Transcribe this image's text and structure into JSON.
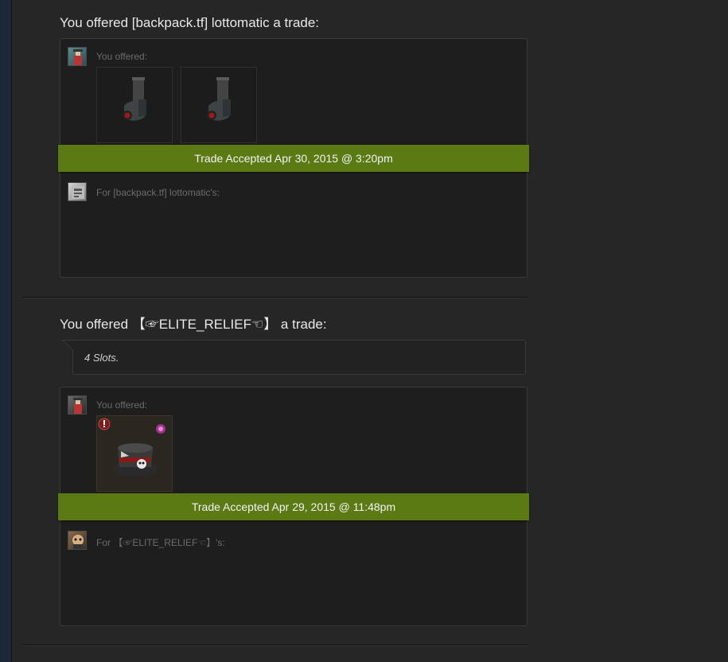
{
  "trades": [
    {
      "title": "You offered [backpack.tf] lottomatic a trade:",
      "you_offered_label": "You offered:",
      "items": [
        "boot-item",
        "boot-item"
      ],
      "status": "Trade Accepted Apr 30, 2015 @ 3:20pm",
      "for_label": "For [backpack.tf] lottomatic's:"
    },
    {
      "title": "You offered 【☞ELITE_RELIEF☜】 a trade:",
      "comment": "4 Slots.",
      "you_offered_label": "You offered:",
      "items": [
        "unusual-hat-item"
      ],
      "status": "Trade Accepted Apr 29, 2015 @ 11:48pm",
      "for_label": "For 【☞ELITE_RELIEF☜】's:"
    }
  ],
  "colors": {
    "status_green": "#5b7a14",
    "panel": "#1e1e1e",
    "background": "#262626"
  }
}
